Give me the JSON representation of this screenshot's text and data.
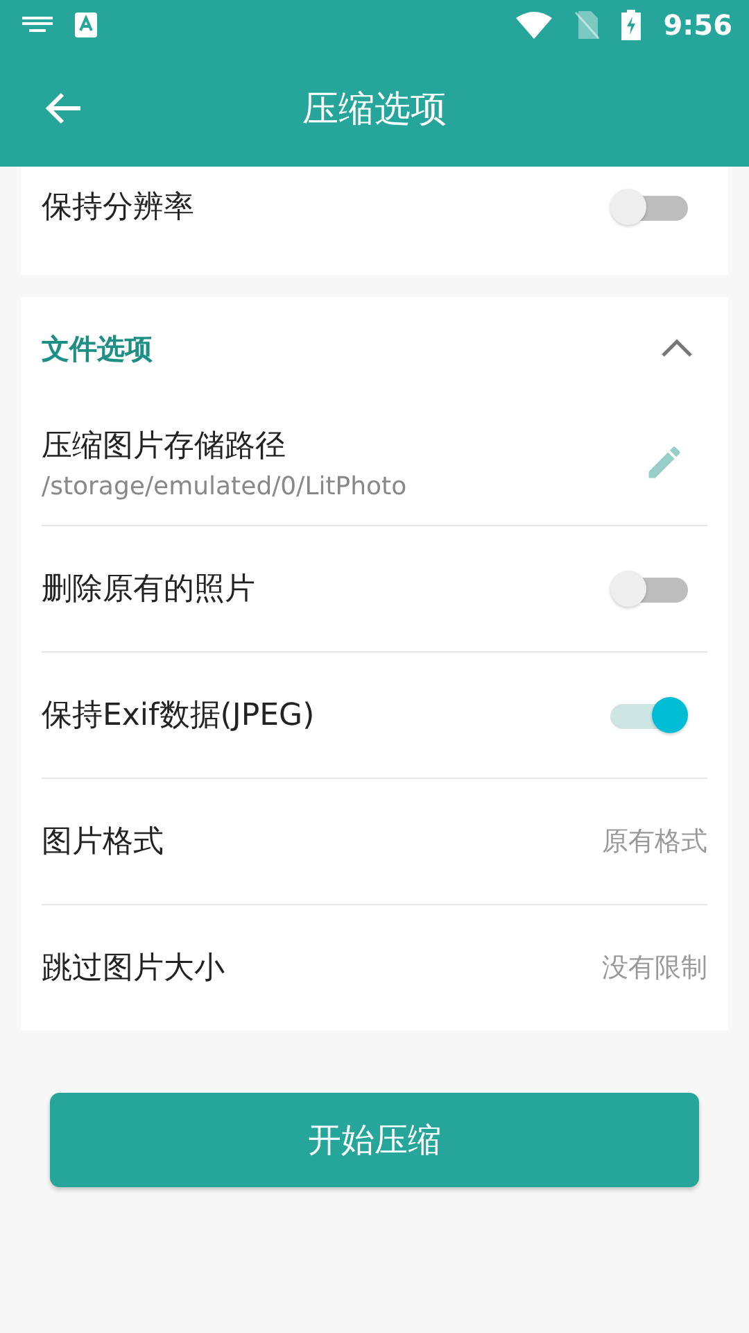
{
  "status_bar": {
    "time": "9:56"
  },
  "app_bar": {
    "title": "压缩选项"
  },
  "top_card": {
    "rows": [
      {
        "kind": "toggle",
        "label": "保持分辨率",
        "on": false
      }
    ]
  },
  "file_options": {
    "title": "文件选项",
    "expanded": true,
    "rows": [
      {
        "kind": "path",
        "label": "压缩图片存储路径",
        "value": "/storage/emulated/0/LitPhoto"
      },
      {
        "kind": "toggle",
        "label": "删除原有的照片",
        "on": false
      },
      {
        "kind": "toggle",
        "label": "保持Exif数据(JPEG)",
        "on": true
      },
      {
        "kind": "value",
        "label": "图片格式",
        "value": "原有格式"
      },
      {
        "kind": "value",
        "label": "跳过图片大小",
        "value": "没有限制"
      }
    ]
  },
  "start_button": "开始压缩"
}
